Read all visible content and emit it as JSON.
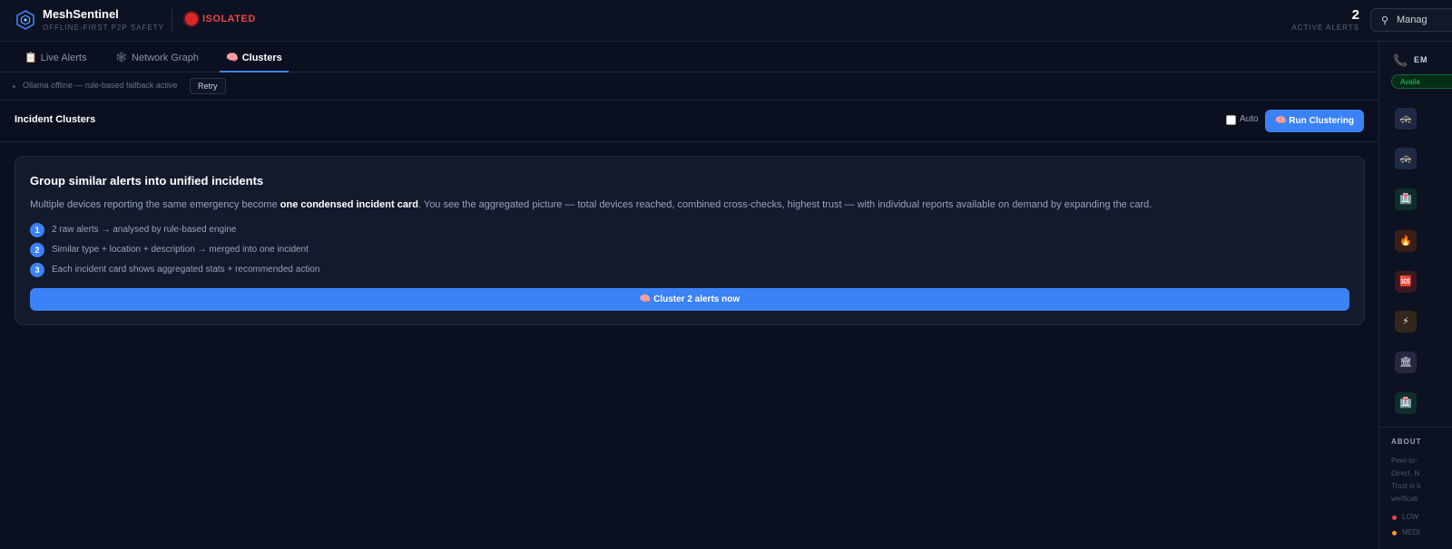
{
  "header": {
    "brand_name": "MeshSentinel",
    "brand_tagline": "OFFLINE-FIRST P2P SAFETY",
    "status": "ISOLATED",
    "active_alerts_count": "2",
    "active_alerts_label": "ACTIVE ALERTS",
    "manage_label": "Manag"
  },
  "tabs": [
    {
      "icon": "📋",
      "label": "Live Alerts"
    },
    {
      "icon": "🕸",
      "label": "Network Graph"
    },
    {
      "icon": "🧠",
      "label": "Clusters"
    }
  ],
  "notice": {
    "text": "Ollama offline — rule-based fallback active",
    "retry_label": "Retry"
  },
  "toolbar": {
    "title": "Incident Clusters",
    "auto_label": "Auto",
    "run_label": "🧠 Run Clustering"
  },
  "card": {
    "title": "Group similar alerts into unified incidents",
    "desc_before": "Multiple devices reporting the same emergency become ",
    "desc_bold": "one condensed incident card",
    "desc_after": ". You see the aggregated picture — total devices reached, combined cross-checks, highest trust — with individual reports available on demand by expanding the card.",
    "steps": [
      {
        "num": "1",
        "text": "2 raw alerts → analysed by rule-based engine"
      },
      {
        "num": "2",
        "text": "Similar type + location + description → merged into one incident"
      },
      {
        "num": "3",
        "text": "Each incident card shows aggregated stats + recommended action"
      }
    ],
    "cluster_button": "🧠 Cluster 2 alerts now"
  },
  "sidebar": {
    "phone_icon": "📞",
    "title_fragment": "EM",
    "available_label": "Availa",
    "items": [
      {
        "icon": "🚓",
        "bg": "#1e2a44"
      },
      {
        "icon": "🚓",
        "bg": "#1e2a44"
      },
      {
        "icon": "🏥",
        "bg": "#0f2e2a"
      },
      {
        "icon": "🔥",
        "bg": "#3a1f17"
      },
      {
        "icon": "🆘",
        "bg": "#3a1820"
      },
      {
        "icon": "⚡",
        "bg": "#33261a"
      },
      {
        "icon": "🏛",
        "bg": "#262640"
      },
      {
        "icon": "🏥",
        "bg": "#0f2e2a"
      }
    ],
    "about_title": "ABOUT",
    "about_lines": [
      "Peer-to-",
      "Direct. N",
      "Trust is b",
      "verificati"
    ],
    "legend": [
      {
        "label": "LOW",
        "color": "#ef4444"
      },
      {
        "label": "MEDI",
        "color": "#f59e0b"
      }
    ]
  },
  "colors": {
    "accent": "#3b82f6",
    "isolated": "#ef4444",
    "available": "#22c55e"
  }
}
